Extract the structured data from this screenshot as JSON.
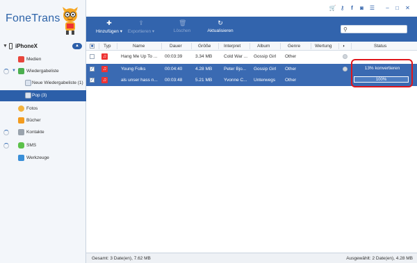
{
  "app": {
    "title": "FoneTrans"
  },
  "device": {
    "name": "iPhoneX"
  },
  "sidebar": {
    "items": [
      {
        "label": "Medien",
        "icon": "media-icon",
        "color": "#e8453c"
      },
      {
        "label": "Wiedergabeliste",
        "icon": "playlist-icon",
        "color": "#4caf50"
      },
      {
        "label": "Neue Wiedergabeliste (1)",
        "icon": "playlist-sub-icon",
        "color": "#dbe3ef"
      },
      {
        "label": "Pop (3)",
        "icon": "playlist-sub-icon",
        "color": "#dbe3ef"
      },
      {
        "label": "Fotos",
        "icon": "photos-icon",
        "color": "#f3b33d"
      },
      {
        "label": "Bücher",
        "icon": "books-icon",
        "color": "#f39c1f"
      },
      {
        "label": "Kontakte",
        "icon": "contacts-icon",
        "color": "#9aa3ad"
      },
      {
        "label": "SMS",
        "icon": "sms-icon",
        "color": "#5cc14a"
      },
      {
        "label": "Werkzeuge",
        "icon": "tools-icon",
        "color": "#3a8fd8"
      }
    ]
  },
  "toolbar": {
    "add": "Hinzufügen",
    "export": "Exportieren",
    "delete": "Löschen",
    "refresh": "Aktualisieren",
    "search_placeholder": ""
  },
  "table": {
    "headers": {
      "type": "Typ",
      "name": "Name",
      "duration": "Dauer",
      "size": "Größe",
      "artist": "Interpret",
      "album": "Album",
      "genre": "Genre",
      "rating": "Wertung",
      "status": "Status"
    },
    "rows": [
      {
        "name": "Hang Me Up To ...",
        "duration": "00:03:39",
        "size": "3.34 MB",
        "artist": "Cold War ...",
        "album": "Gossip Girl",
        "genre": "Other",
        "checked": false,
        "selected": false
      },
      {
        "name": "Young Folks",
        "duration": "00:04:40",
        "size": "4.28 MB",
        "artist": "Peter Bjo...",
        "album": "Gossip Girl",
        "genre": "Other",
        "checked": true,
        "selected": true
      },
      {
        "name": "als unser hass n...",
        "duration": "00:03:48",
        "size": "5.21 MB",
        "artist": "Yvonne C...",
        "album": "Unterwegs",
        "genre": "Other",
        "checked": true,
        "selected": true
      }
    ],
    "status_convert": "13% konvertieren",
    "status_progress": "100%",
    "progress_fraction": 1.0
  },
  "statusbar": {
    "left": "Gesamt: 3 Date(en), 7.62 MB",
    "right": "Ausgewählt: 2 Date(en), 4.28 MB"
  },
  "colors": {
    "accent": "#3264ad",
    "highlight": "#e0161b"
  }
}
